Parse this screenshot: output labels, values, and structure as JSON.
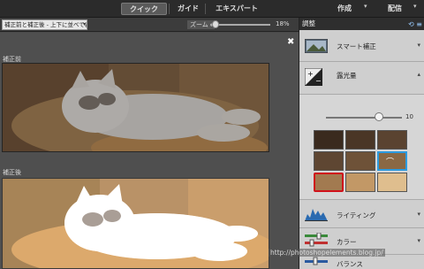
{
  "topbar": {
    "quick": "クイック",
    "guide": "ガイド",
    "expert": "エキスパート",
    "create": "作成",
    "share": "配信"
  },
  "options": {
    "view_select": "補正前と補正後 - 上下に並べて表示",
    "zoom_label": "ズーム :",
    "zoom_value": "18%",
    "zoom_level": 0.18
  },
  "canvas": {
    "before_label": "補正前",
    "after_label": "補正後"
  },
  "panel": {
    "title": "調整",
    "items": [
      {
        "label": "スマート補正",
        "icon": "smart-fix-icon",
        "state": "collapsed"
      },
      {
        "label": "露光量",
        "icon": "exposure-icon",
        "state": "expanded"
      },
      {
        "label": "ライティング",
        "icon": "lighting-icon",
        "state": "collapsed"
      },
      {
        "label": "カラー",
        "icon": "color-icon",
        "state": "collapsed"
      },
      {
        "label": "バランス",
        "icon": "balance-icon",
        "state": "collapsed"
      }
    ],
    "exposure_value": "10",
    "exposure_slider_level": 0.8
  },
  "watermark": "http://photoshopelements.blog.jp/",
  "colors": {
    "panel_bg": "#d8d8d8",
    "selected_border": "#2c9be0",
    "highlight_border": "#d0121b"
  }
}
